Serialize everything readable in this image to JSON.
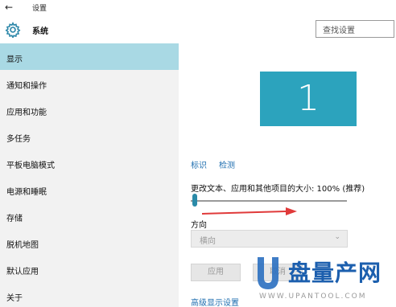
{
  "window": {
    "title": "设置",
    "back_icon": "←"
  },
  "header": {
    "app_name": "系统",
    "search_placeholder": "查找设置"
  },
  "sidebar": {
    "items": [
      {
        "label": "显示",
        "active": true
      },
      {
        "label": "通知和操作",
        "active": false
      },
      {
        "label": "应用和功能",
        "active": false
      },
      {
        "label": "多任务",
        "active": false
      },
      {
        "label": "平板电脑模式",
        "active": false
      },
      {
        "label": "电源和睡眠",
        "active": false
      },
      {
        "label": "存储",
        "active": false
      },
      {
        "label": "脱机地图",
        "active": false
      },
      {
        "label": "默认应用",
        "active": false
      },
      {
        "label": "关于",
        "active": false
      }
    ]
  },
  "display": {
    "monitor_number": "1",
    "identify_link": "标识",
    "detect_link": "检测",
    "scale_label": "更改文本、应用和其他项目的大小: 100% (推荐)",
    "scale_percent": 100,
    "orientation_label": "方向",
    "orientation_value": "横向",
    "apply_button": "应用",
    "cancel_button": "取消",
    "advanced_link": "高级显示设置"
  },
  "watermark": {
    "brand": "盘量产网",
    "url": "WWW.UPANTOOL.COM"
  },
  "colors": {
    "accent": "#2ca3bd",
    "sidebar_active": "#a9d9e4",
    "link": "#1f6fb0",
    "annotation_arrow": "#e03a3a"
  }
}
